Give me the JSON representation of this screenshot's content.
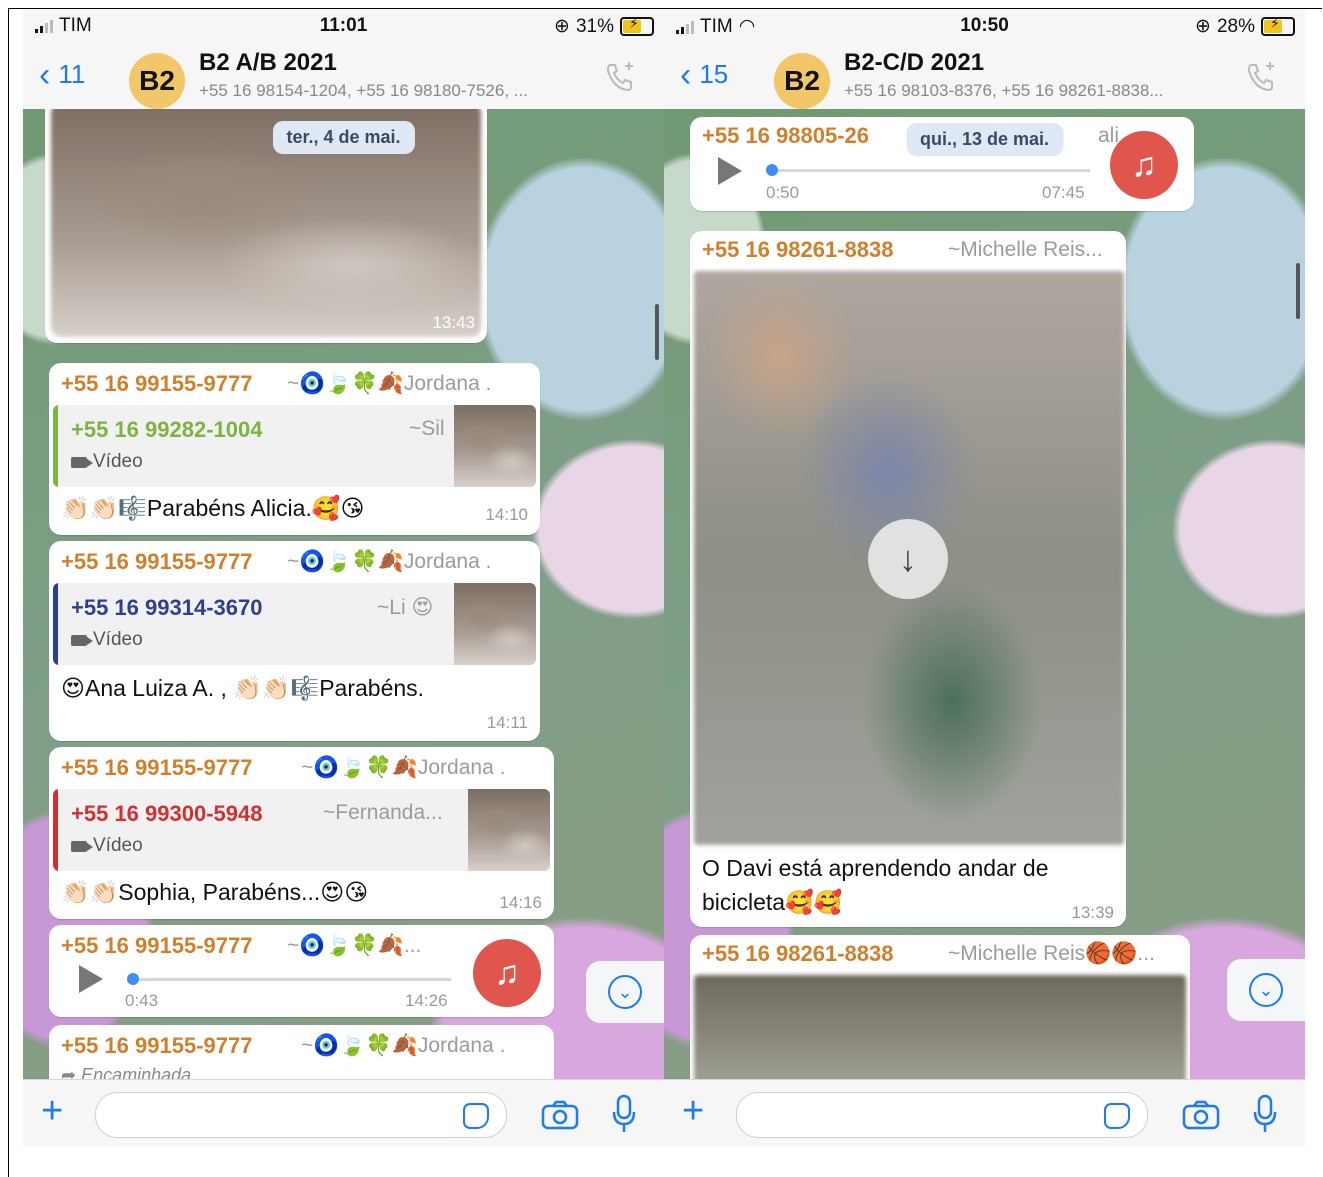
{
  "left": {
    "status": {
      "carrier": "TIM",
      "time": "11:01",
      "battery": "31%"
    },
    "header": {
      "back_count": "11",
      "avatar": "B2",
      "title": "B2 A/B 2021",
      "subtitle": "+55 16 98154-1204, +55 16 98180-7526, ..."
    },
    "date_pill": "ter., 4 de mai.",
    "video_time": "13:43",
    "messages": [
      {
        "sender": "+55 16 99155-9777",
        "sender_suffix": "~🧿🍃🍀🍂Jordana .",
        "quote": {
          "number": "+55 16 99282-1004",
          "name": "~Sil",
          "type": "Vídeo",
          "color": "#7cb342"
        },
        "text": "👏🏻👏🏻🎼Parabéns  Alicia.🥰😘",
        "time": "14:10"
      },
      {
        "sender": "+55 16 99155-9777",
        "sender_suffix": "~🧿🍃🍀🍂Jordana .",
        "quote": {
          "number": "+55 16 99314-3670",
          "name": "~Li 😍",
          "type": "Vídeo",
          "color": "#2f3f8f"
        },
        "text": "😍Ana Luiza A. , 👏🏻👏🏻🎼Parabéns.",
        "time": "14:11"
      },
      {
        "sender": "+55 16 99155-9777",
        "sender_suffix": "~🧿🍃🍀🍂Jordana .",
        "quote": {
          "number": "+55 16 99300-5948",
          "name": "~Fernanda...",
          "type": "Vídeo",
          "color": "#d32f2f"
        },
        "text": "👏🏻👏🏻Sophia, Parabéns...😍😘",
        "time": "14:16"
      }
    ],
    "audio": {
      "sender": "+55 16 99155-9777",
      "sender_suffix": "~🧿🍃🍀🍂...",
      "elapsed": "0:43",
      "time": "14:26",
      "progress": 0.02
    },
    "last": {
      "sender": "+55 16 99155-9777",
      "sender_suffix": "~🧿🍃🍀🍂Jordana .",
      "forwarded": "Encaminhada"
    }
  },
  "right": {
    "status": {
      "carrier": "TIM",
      "time": "10:50",
      "battery": "28%"
    },
    "header": {
      "back_count": "15",
      "avatar": "B2",
      "title": "B2-C/D 2021",
      "subtitle": "+55 16 98103-8376, +55 16 98261-8838..."
    },
    "date_pill": "qui., 13 de mai.",
    "audio": {
      "sender": "+55 16 98805-26",
      "sender_suffix": "ali",
      "elapsed": "0:50",
      "time": "07:45",
      "progress": 0.02
    },
    "media_msg": {
      "sender": "+55 16 98261-8838",
      "sender_name": "~Michelle Reis...",
      "caption_line1": "O Davi está aprendendo andar de",
      "caption_line2": "bicicleta🥰🥰",
      "time": "13:39"
    },
    "next": {
      "sender": "+55 16 98261-8838",
      "sender_name": "~Michelle Reis🏀🏀..."
    }
  },
  "colors": {
    "accent": "#1a7bf2",
    "sender": "#d27f2a",
    "music": "#e0564c"
  }
}
